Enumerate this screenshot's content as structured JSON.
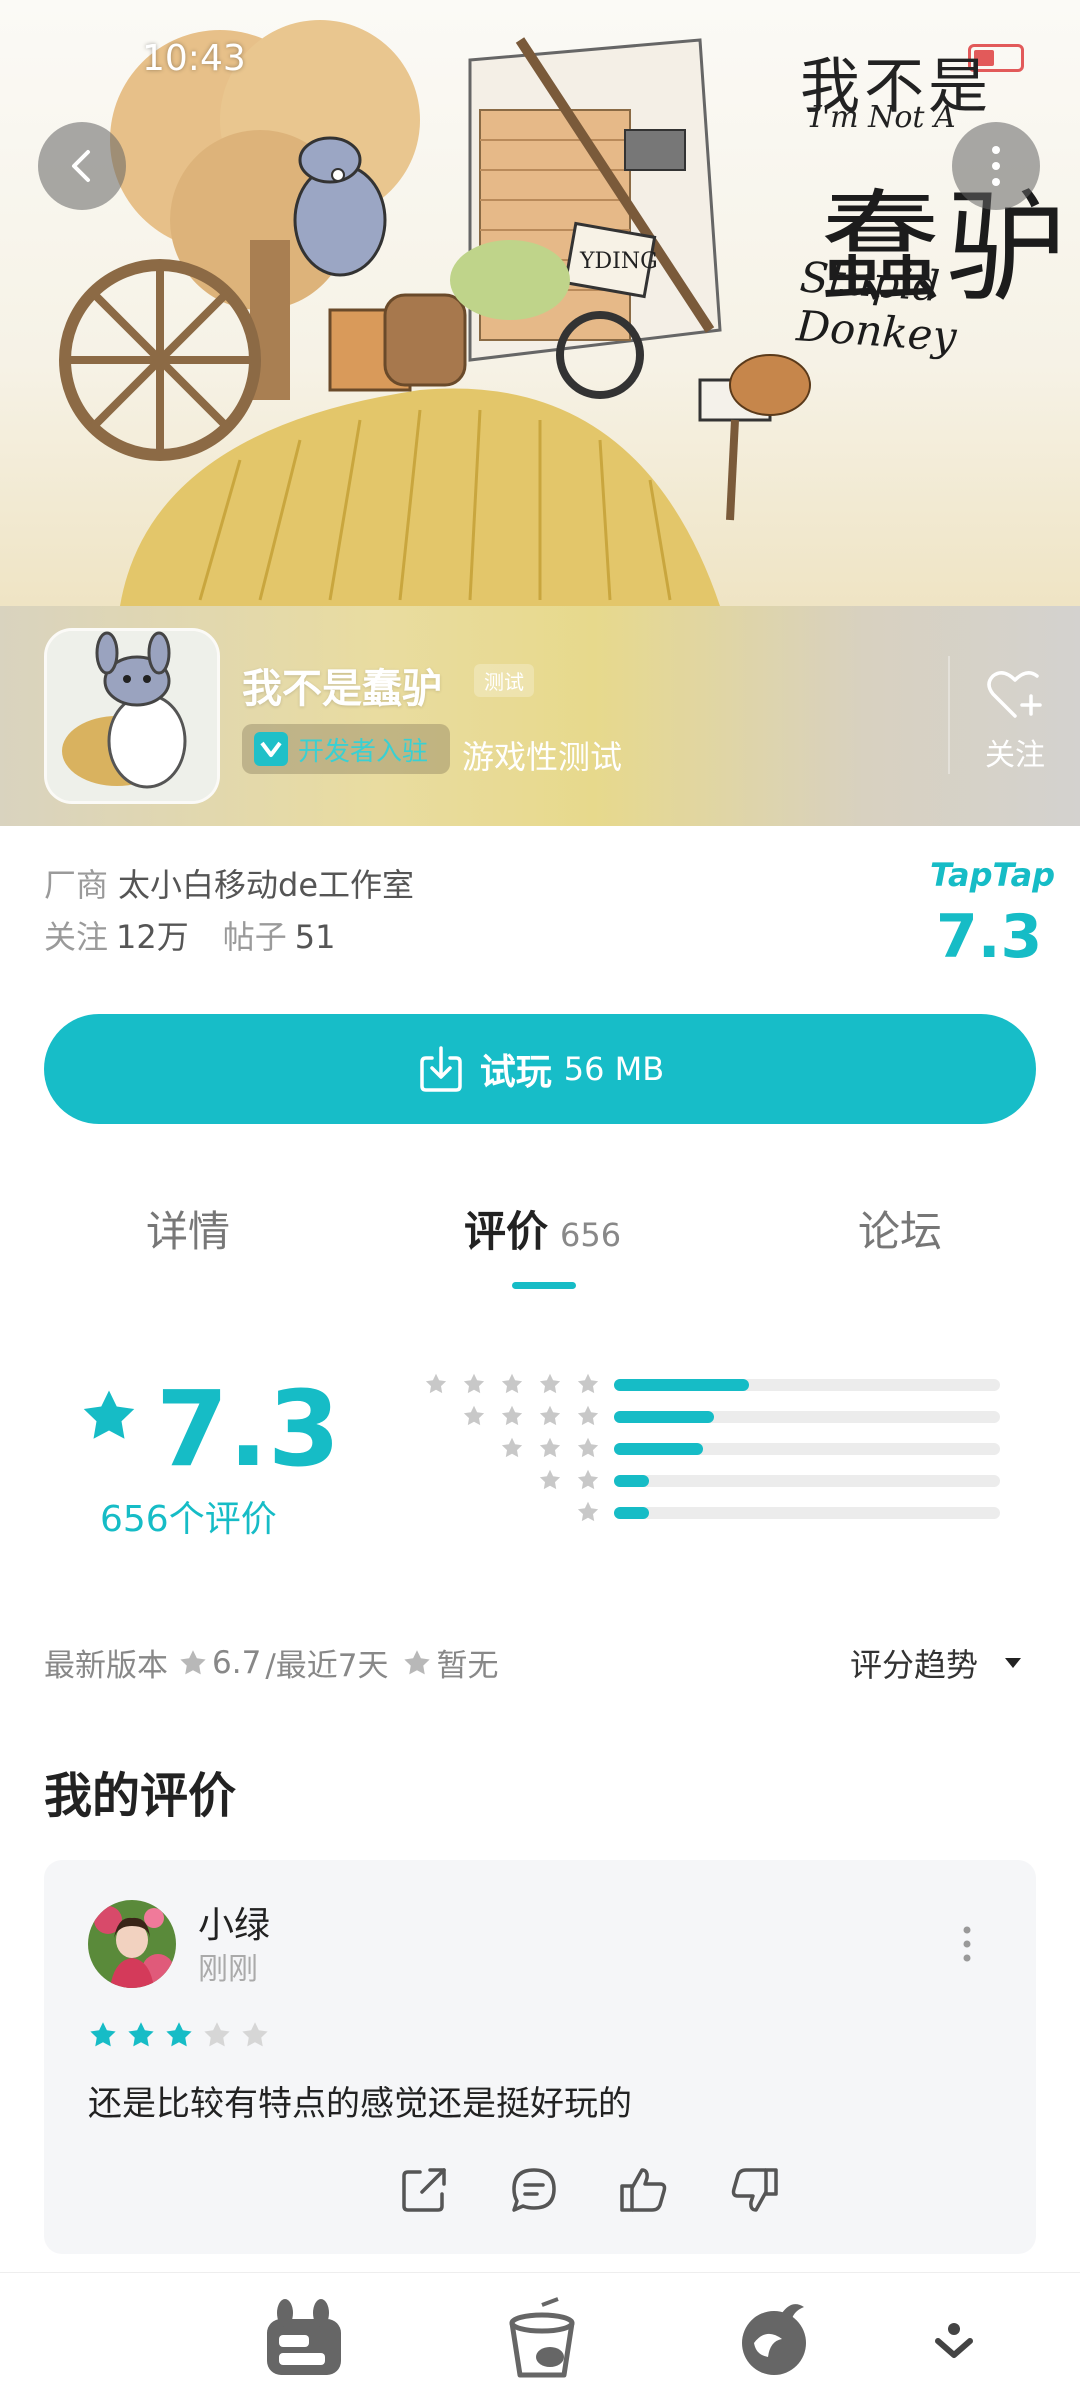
{
  "status_bar": {
    "time": "10:43"
  },
  "hero": {
    "title_cn_top": "我不是",
    "title_en_top": "I'm Not A",
    "title_cn_main": "蠢驴",
    "title_en_main": "Stupid Donkey",
    "sign_text": "YDING"
  },
  "game": {
    "name": "我不是蠢驴",
    "test_tag": "测试",
    "dev_badge": "开发者入驻",
    "type": "游戏性测试",
    "follow_label": "关注"
  },
  "info": {
    "vendor_label": "厂商",
    "vendor_name": "太小白移动de工作室",
    "follow_label": "关注",
    "follow_count": "12万",
    "posts_label": "帖子",
    "posts_count": "51",
    "platform_logo": "TapTap",
    "platform_score": "7.3"
  },
  "download": {
    "label": "试玩",
    "size": "56 MB"
  },
  "tabs": {
    "detail": "详情",
    "review": "评价",
    "review_count": "656",
    "forum": "论坛"
  },
  "rating": {
    "score": "7.3",
    "count_text": "656个评价",
    "distribution": [
      {
        "stars": 5,
        "fraction": 0.35
      },
      {
        "stars": 4,
        "fraction": 0.26
      },
      {
        "stars": 3,
        "fraction": 0.23
      },
      {
        "stars": 2,
        "fraction": 0.09
      },
      {
        "stars": 1,
        "fraction": 0.09
      }
    ]
  },
  "version": {
    "latest_label": "最新版本",
    "latest_score": "6.7",
    "recent_label": "/最近7天",
    "recent_score": "暂无",
    "trend_label": "评分趋势"
  },
  "my_review": {
    "title": "我的评价",
    "user_name": "小绿",
    "time": "刚刚",
    "stars": 3,
    "max_stars": 5,
    "text": "还是比较有特点的感觉还是挺好玩的"
  },
  "colors": {
    "accent": "#16bcc6",
    "star_empty": "#c8c8c8"
  }
}
